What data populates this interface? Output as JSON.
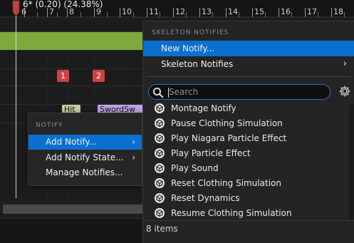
{
  "timeline": {
    "readout": "6* (0.20) (24.38%)",
    "ruler_labels": [
      "6",
      "7",
      "8",
      "9",
      "10",
      "11",
      "12",
      "13",
      "14",
      "15",
      "16",
      "17",
      "18"
    ],
    "markers": [
      "1",
      "2"
    ],
    "notify_chips": [
      "Hit",
      "SwordSw"
    ],
    "colors": {
      "track": "#7fa93c",
      "marker": "#cd4242",
      "chip_hit": "#c3cfa0",
      "chip_sword": "#b9a6e6",
      "playhead": "#b5493b"
    }
  },
  "context_menu": {
    "header": "NOTIFY",
    "items": [
      {
        "label": "Add Notify...",
        "submenu": true,
        "selected": true
      },
      {
        "label": "Add Notify State...",
        "submenu": true,
        "selected": false
      },
      {
        "label": "Manage Notifies...",
        "submenu": false,
        "selected": false
      }
    ]
  },
  "panel": {
    "header": "SKELETON NOTIFIES",
    "items": [
      {
        "label": "New Notify...",
        "selected": true,
        "submenu": false
      },
      {
        "label": "Skeleton Notifies",
        "selected": false,
        "submenu": true
      }
    ],
    "search": {
      "value": "",
      "placeholder": "Search",
      "icon": "search-icon"
    },
    "settings_icon": "gear-icon",
    "notifies": [
      "Montage Notify",
      "Pause Clothing Simulation",
      "Play Niagara Particle Effect",
      "Play Particle Effect",
      "Play Sound",
      "Reset Clothing Simulation",
      "Reset Dynamics",
      "Resume Clothing Simulation"
    ],
    "notify_icon": "class-icon",
    "footer": "8 items",
    "colors": {
      "selection": "#0b6fd0",
      "search_border": "#2a72c8"
    }
  }
}
